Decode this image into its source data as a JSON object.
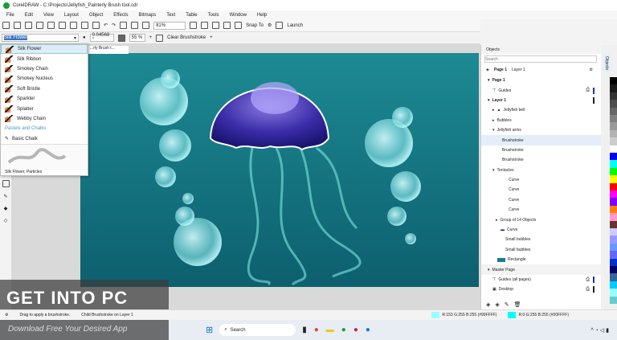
{
  "title": "CorelDRAW - C:\\Projects\\Jellyfish_Painterly Brush tool.cdr",
  "menu": [
    "File",
    "Edit",
    "View",
    "Layout",
    "Object",
    "Effects",
    "Bitmaps",
    "Text",
    "Table",
    "Tools",
    "Window",
    "Help"
  ],
  "toolbar": {
    "zoom": "81%",
    "snap": "Snap To",
    "launch": "Launch"
  },
  "propbar": {
    "brush_value": "Silk Flower",
    "size": "0.04568 \"",
    "opacity": "55 %",
    "clear": "Clear Brushstroke"
  },
  "doc_tab": "...rly Brush t...",
  "dropdown": {
    "items": [
      "Silk Flower",
      "Silk Ribbon",
      "Smokey Chain",
      "Smokey Nucleus",
      "Soft Bristle",
      "Sparkler",
      "Splatter",
      "Webby Chain"
    ],
    "category": "Pastels and Chalks",
    "chalk": "Basic Chalk",
    "preview_label": "Silk Flower, Particles"
  },
  "objects": {
    "title": "Objects",
    "search_placeholder": "Search",
    "page": "Page 1",
    "layer": "Layer 1",
    "side_tab": "Objects",
    "rows": [
      "Page 1",
      "Guides",
      "Layer 1",
      "Jellyfish bell",
      "Bubbles",
      "Jellyfish arms",
      "Brushstroke",
      "Brushstroke",
      "Brushstroke",
      "Tentacles",
      "Curve",
      "Curve",
      "Curve",
      "Curve",
      "Group of 14 Objects",
      "Curve",
      "Small bubbles",
      "Small bubbles",
      "Rectangle",
      "Master Page",
      "Guides (all pages)",
      "Desktop"
    ]
  },
  "palette": [
    "#000000",
    "#1a1a1a",
    "#333333",
    "#4d4d4d",
    "#666666",
    "#808080",
    "#999999",
    "#b3b3b3",
    "#cccccc",
    "#ffffff",
    "#0000ff",
    "#00ffff",
    "#00ff00",
    "#ffff00",
    "#ff0000",
    "#ff00ff",
    "#8000ff",
    "#ff8000",
    "#ff99cc",
    "#663333",
    "#ccccff",
    "#9999ff",
    "#6699ff",
    "#6666ff",
    "#0033cc",
    "#000066",
    "#336699",
    "#00ccff",
    "#99ffff",
    "#66cccc"
  ],
  "status": {
    "hint": "Drag to apply a brushstroke.",
    "context": "Child Brushstroke on Layer 1",
    "fill": "R:153 G:255 B:255 (#99FFFF)",
    "outline": "R:0 G:255 B:255 (#00FFFF)"
  },
  "taskbar": {
    "search": "Search"
  },
  "watermark": {
    "brand": "GET INTO PC",
    "tagline": "Download Free Your Desired App"
  }
}
